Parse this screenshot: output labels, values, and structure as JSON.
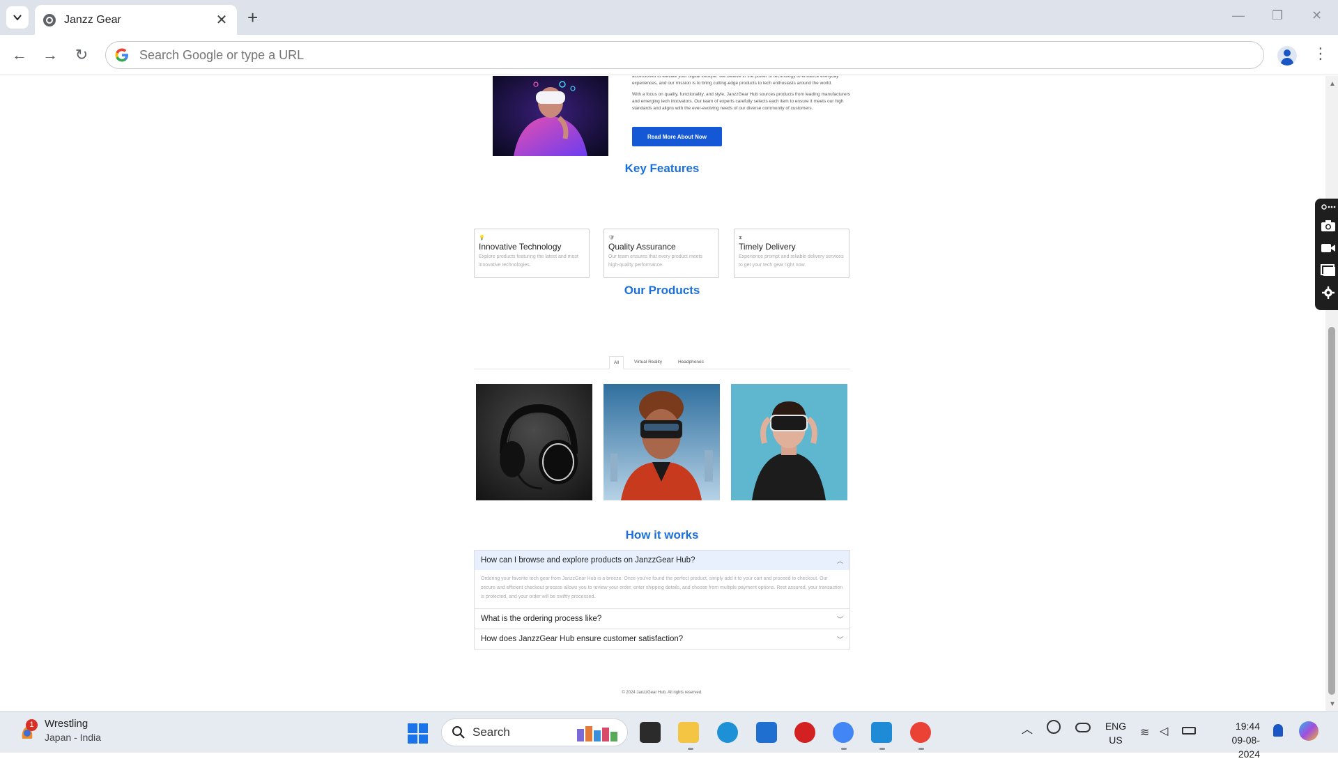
{
  "browser": {
    "tab_title": "Janzz Gear",
    "new_tab_label": "+",
    "close_tab_label": "✕",
    "omnibox_placeholder": "Search Google or type a URL",
    "window_controls": {
      "minimize": "—",
      "restore": "❐",
      "close": "✕"
    },
    "nav": {
      "back": "←",
      "forward": "→",
      "reload": "↻"
    },
    "menu_label": "⋮"
  },
  "about": {
    "paragraph1": "accessories to elevate your digital lifestyle. We believe in the power of technology to enhance everyday experiences, and our mission is to bring cutting-edge products to tech enthusiasts around the world.",
    "paragraph2": "With a focus on quality, functionality, and style, JanzzGear Hub sources products from leading manufacturers and emerging tech innovators. Our team of experts carefully selects each item to ensure it meets our high standards and aligns with the ever-evolving needs of our diverse community of customers.",
    "button_label": "Read More About Now"
  },
  "features": {
    "title": "Key Features",
    "items": [
      {
        "icon": "lightbulb-icon",
        "glyph": "💡",
        "title": "Innovative Technology",
        "description": "Explore products featuring the latest and most innovative technologies."
      },
      {
        "icon": "shield-check-icon",
        "glyph": "🛡",
        "title": "Quality Assurance",
        "description": "Our team ensures that every product meets high-quality performance."
      },
      {
        "icon": "hourglass-icon",
        "glyph": "⧗",
        "title": "Timely Delivery",
        "description": "Experience prompt and reliable delivery services to get your tech gear right now."
      }
    ]
  },
  "products": {
    "title": "Our Products",
    "tabs": [
      "All",
      "Virtual Reality",
      "Headphones"
    ],
    "active_tab": "All"
  },
  "faq": {
    "title": "How it works",
    "items": [
      {
        "question": "How can I browse and explore products on JanzzGear Hub?",
        "answer": "Ordering your favorite tech gear from JanzzGear Hub is a breeze. Once you've found the perfect product, simply add it to your cart and proceed to checkout. Our secure and efficient checkout process allows you to review your order, enter shipping details, and choose from multiple payment options. Rest assured, your transaction is protected, and your order will be swiftly processed.",
        "open": true
      },
      {
        "question": "What is the ordering process like?",
        "open": false
      },
      {
        "question": "How does JanzzGear Hub ensure customer satisfaction?",
        "open": false
      }
    ]
  },
  "footer": {
    "text": "© 2024 JanzzGear Hub. All rights reserved."
  },
  "taskbar": {
    "weather_badge": "1",
    "weather_title": "Wrestling",
    "weather_subtitle": "Japan - India",
    "search_label": "Search",
    "lang_line1": "ENG",
    "lang_line2": "US",
    "time": "19:44",
    "date": "09-08-2024"
  },
  "colors": {
    "accent": "#1a6fd9",
    "button": "#1558d6",
    "faq_open_bg": "#e8f0fe"
  }
}
